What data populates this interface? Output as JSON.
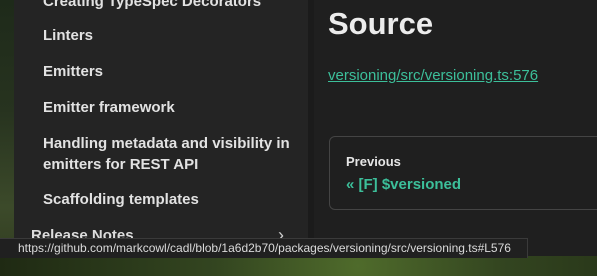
{
  "sidebar": {
    "items": [
      {
        "label": "Creating TypeSpec Decorators"
      },
      {
        "label": "Linters"
      },
      {
        "label": "Emitters"
      },
      {
        "label": "Emitter framework"
      },
      {
        "label": "Handling metadata and visibility in emitters for REST API"
      },
      {
        "label": "Scaffolding templates"
      },
      {
        "label": "Release Notes"
      }
    ],
    "release_chevron": "chevron-right-icon"
  },
  "main": {
    "title": "Source",
    "source_link": "versioning/src/versioning.ts:576",
    "previous": {
      "label": "Previous",
      "link": "« [F] $versioned"
    }
  },
  "statusbar": {
    "url": "https://github.com/markcowl/cadl/blob/1a6d2b70/packages/versioning/src/versioning.ts#L576"
  },
  "colors": {
    "accent": "#3cbf9a",
    "sidebar_bg": "#242424",
    "main_bg": "#1f1f1f"
  }
}
